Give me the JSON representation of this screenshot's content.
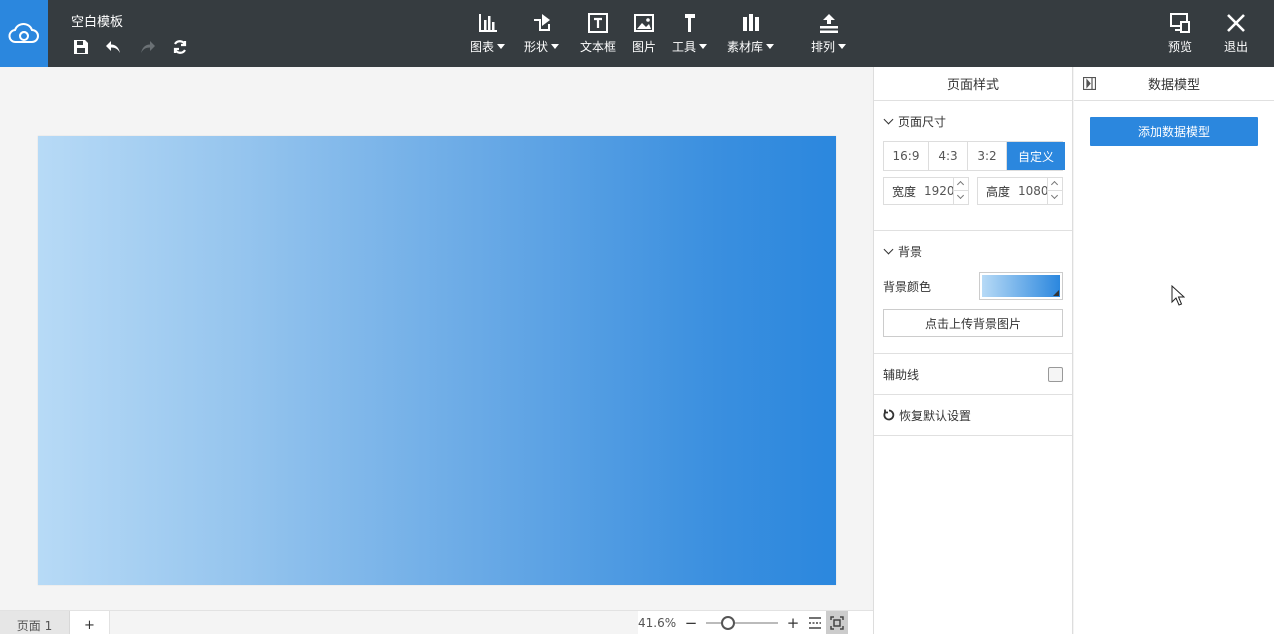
{
  "app": {
    "title": "空白模板",
    "brand_color": "#2b87de",
    "topbar_color": "#363c40"
  },
  "quick_actions": [
    {
      "name": "save-icon"
    },
    {
      "name": "undo-icon"
    },
    {
      "name": "redo-icon",
      "disabled": true
    },
    {
      "name": "refresh-icon"
    }
  ],
  "toolbar": {
    "chart": "图表",
    "shape": "形状",
    "textbox": "文本框",
    "image": "图片",
    "tools": "工具",
    "assets": "素材库",
    "arrange": "排列"
  },
  "header_right": {
    "preview": "预览",
    "exit": "退出"
  },
  "canvas": {
    "gradient_start": "#b7daf6",
    "gradient_end": "#2b87de"
  },
  "bottom": {
    "page_tab": "页面 1",
    "add_page": "+",
    "zoom": "41.6%",
    "zoom_out": "−",
    "zoom_in": "+",
    "zoom_slider_fraction": 0.25
  },
  "page_style": {
    "panel_title": "页面样式",
    "size_section": "页面尺寸",
    "ratios": [
      "16:9",
      "4:3",
      "3:2",
      "自定义"
    ],
    "active_ratio": "自定义",
    "width_label": "宽度",
    "width_value": "1920",
    "height_label": "高度",
    "height_value": "1080",
    "bg_section": "背景",
    "bg_color_label": "背景颜色",
    "upload_bg": "点击上传背景图片",
    "guides": "辅助线",
    "guides_checked": false,
    "reset": "恢复默认设置"
  },
  "data_model": {
    "panel_title": "数据模型",
    "add_button": "添加数据模型"
  }
}
